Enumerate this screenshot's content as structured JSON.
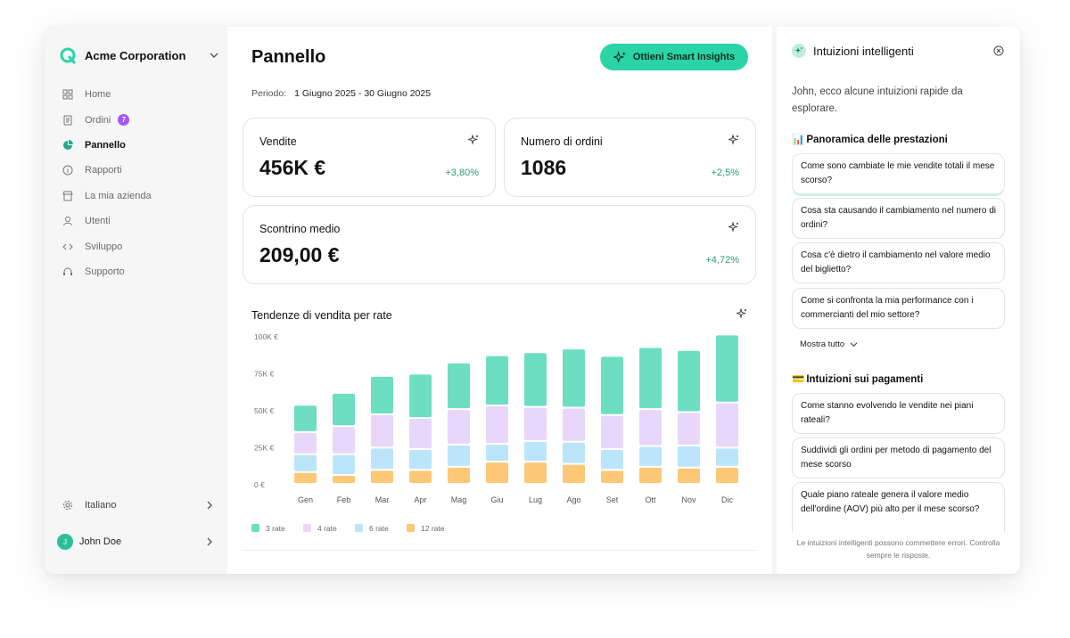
{
  "sidebar": {
    "company": "Acme Corporation",
    "nav": [
      {
        "label": "Home",
        "icon": "grid-icon"
      },
      {
        "label": "Ordini",
        "icon": "receipt-icon",
        "badge": "7"
      },
      {
        "label": "Pannello",
        "icon": "pie-chart-icon",
        "active": true
      },
      {
        "label": "Rapporti",
        "icon": "info-icon"
      },
      {
        "label": "La mia azienda",
        "icon": "store-icon"
      },
      {
        "label": "Utenti",
        "icon": "user-icon"
      },
      {
        "label": "Sviluppo",
        "icon": "code-icon"
      },
      {
        "label": "Supporto",
        "icon": "headset-icon"
      }
    ],
    "language": "Italiano",
    "user": {
      "name": "John Doe",
      "initial": "J"
    }
  },
  "main": {
    "title": "Pannello",
    "insights_button": "Ottieni Smart Insights",
    "period_label": "Periodo:",
    "period_value": "1 Giugno 2025 - 30 Giugno 2025",
    "cards": [
      {
        "title": "Vendite",
        "value": "456K €",
        "delta": "+3,80%"
      },
      {
        "title": "Numero di ordini",
        "value": "1086",
        "delta": "+2,5%"
      },
      {
        "title": "Scontrino medio",
        "value": "209,00 €",
        "delta": "+4,72%"
      }
    ]
  },
  "chart_data": {
    "type": "bar",
    "stacked": true,
    "title": "Tendenze di vendita per rate",
    "categories": [
      "Gen",
      "Feb",
      "Mar",
      "Apr",
      "Mag",
      "Giu",
      "Lug",
      "Ago",
      "Set",
      "Ott",
      "Nov",
      "Dic"
    ],
    "y_ticks": [
      "100K €",
      "75K €",
      "50K €",
      "25K €",
      "0 €"
    ],
    "ylim": [
      0,
      100000
    ],
    "series": [
      {
        "name": "12 rate",
        "color": "#fcc877",
        "values": [
          8000,
          6000,
          9500,
          9500,
          11500,
          15000,
          15000,
          13500,
          9500,
          11500,
          11000,
          11500
        ]
      },
      {
        "name": "6 rate",
        "color": "#bce5fb",
        "values": [
          12000,
          14000,
          15000,
          14000,
          15000,
          12000,
          14000,
          15000,
          14000,
          14000,
          15000,
          13000
        ]
      },
      {
        "name": "4 rate",
        "color": "#e8d7fa",
        "values": [
          15000,
          19000,
          22500,
          21000,
          24000,
          26000,
          23000,
          23000,
          23000,
          25000,
          22500,
          30500
        ]
      },
      {
        "name": "3 rate",
        "color": "#6edec3",
        "values": [
          18500,
          22500,
          26000,
          30000,
          31500,
          34000,
          37000,
          40000,
          40000,
          42000,
          42000,
          46000
        ]
      }
    ],
    "legend": [
      "3 rate",
      "4 rate",
      "6 rate",
      "12 rate"
    ],
    "legend_position": "bottom-left",
    "grid": false
  },
  "panel": {
    "title": "Intuizioni intelligenti",
    "intro": "John, ecco alcune intuizioni rapide da esplorare.",
    "section1": {
      "emoji": "📊",
      "title": "Panoramica delle prestazioni"
    },
    "questions1": [
      "Come sono cambiate le mie vendite totali il mese scorso?",
      "Cosa sta causando il cambiamento nel numero di ordini?",
      "Cosa c'è dietro il cambiamento nel valore medio del biglietto?",
      "Come si confronta la mia performance con i commercianti del mio settore?"
    ],
    "show_all": "Mostra tutto",
    "section2": {
      "emoji": "💳",
      "title": "Intuizioni sui pagamenti"
    },
    "questions2": [
      "Come stanno evolvendo le vendite nei piani rateali?",
      "Suddividi gli ordini per metodo di pagamento del mese scorso",
      "Quale piano rateale genera il valore medio dell'ordine (AOV) più alto per il mese scorso?"
    ],
    "footnote": "Le intuizioni intelligenti possono commettere errori. Controlla sempre le risposte."
  },
  "colors": {
    "accent": "#2bd4a6",
    "positive": "#2a9d6f",
    "badge": "#a855f7"
  }
}
